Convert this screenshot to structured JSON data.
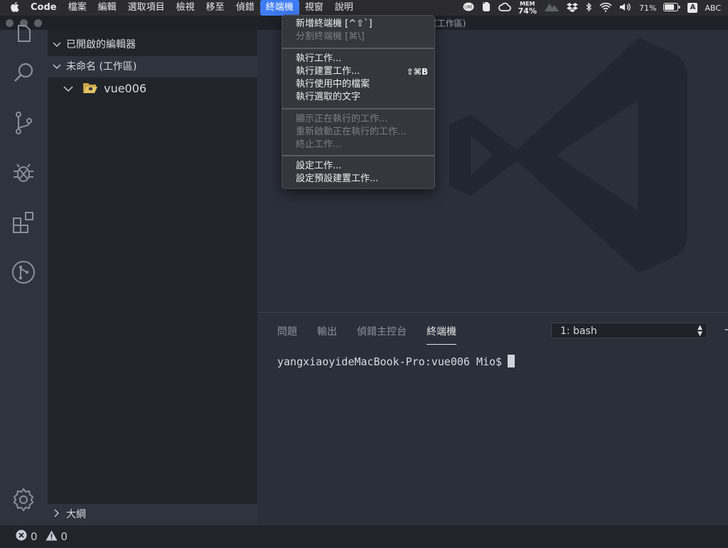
{
  "menubar": {
    "app_name": "Code",
    "items": [
      "檔案",
      "編輯",
      "選取項目",
      "檢視",
      "移至",
      "偵錯",
      "終端機",
      "視窗",
      "說明"
    ],
    "active_index": 6
  },
  "status_menus": {
    "mem_label": "MEM",
    "mem_value": "74%",
    "battery": "71%",
    "input_source": "ABC",
    "input_letter": "A"
  },
  "window": {
    "title_fragment": "(工作區)"
  },
  "sidebar": {
    "open_editors": "已開啟的編輯器",
    "workspace": "未命名 (工作區)",
    "folder": "vue006",
    "outline": "大綱"
  },
  "terminal_menu": {
    "items": [
      {
        "label": "新增終端機 [^⇧`]",
        "disabled": false,
        "shortcut": ""
      },
      {
        "label": "分割終端機 [⌘\\]",
        "disabled": true,
        "shortcut": ""
      },
      {
        "label": "執行工作...",
        "disabled": false,
        "shortcut": ""
      },
      {
        "label": "執行建置工作...",
        "disabled": false,
        "shortcut": "⇧⌘B"
      },
      {
        "label": "執行使用中的檔案",
        "disabled": false,
        "shortcut": ""
      },
      {
        "label": "執行選取的文字",
        "disabled": false,
        "shortcut": ""
      },
      {
        "label": "顯示正在執行的工作...",
        "disabled": true,
        "shortcut": ""
      },
      {
        "label": "重新啟動正在執行的工作...",
        "disabled": true,
        "shortcut": ""
      },
      {
        "label": "終止工作...",
        "disabled": true,
        "shortcut": ""
      },
      {
        "label": "設定工作...",
        "disabled": false,
        "shortcut": ""
      },
      {
        "label": "設定預設建置工作...",
        "disabled": false,
        "shortcut": ""
      }
    ]
  },
  "panel": {
    "tabs": [
      "問題",
      "輸出",
      "偵錯主控台",
      "終端機"
    ],
    "active_tab": 3,
    "terminal_select": "1: bash",
    "prompt": "yangxiaoyideMacBook-Pro:vue006 Mio$"
  },
  "statusbar": {
    "errors": "0",
    "warnings": "0"
  },
  "colors": {
    "menu_highlight": "#3f7cf5",
    "editor_bg": "#2b2f3a",
    "sidebar_bg": "#21252b",
    "activity_bg": "#2f333d",
    "watermark": "#222630"
  }
}
